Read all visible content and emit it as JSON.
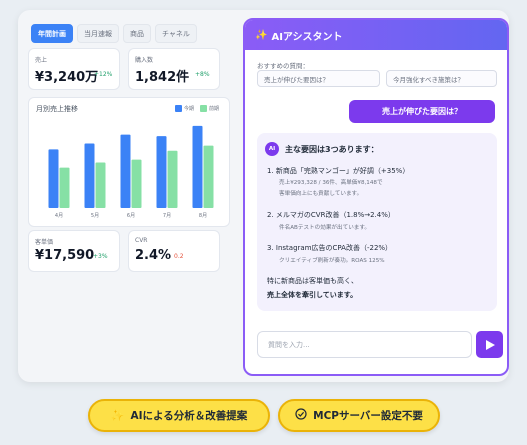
{
  "dashboard": {
    "tabs": [
      {
        "label": "年間計画",
        "active": true
      },
      {
        "label": "当月速報",
        "active": false
      },
      {
        "label": "商品",
        "active": false
      },
      {
        "label": "チャネル",
        "active": false
      }
    ],
    "kpis": [
      {
        "label": "売上",
        "value": "¥3,240万",
        "change": "+12%"
      },
      {
        "label": "購入数",
        "value": "1,842件",
        "change": "+8%"
      },
      {
        "label": "客単価",
        "value": "¥17,590",
        "change": "+3%"
      },
      {
        "label": "CVR",
        "value": "2.4%",
        "change": "0.2"
      }
    ],
    "chart": {
      "title": "月別売上推移",
      "legend": [
        "今期",
        "前期"
      ]
    }
  },
  "chart_data": {
    "type": "bar",
    "categories": [
      "4月",
      "5月",
      "6月",
      "7月",
      "8月"
    ],
    "series": [
      {
        "name": "今期",
        "values": [
          80,
          88,
          100,
          98,
          112
        ]
      },
      {
        "name": "前期",
        "values": [
          55,
          62,
          66,
          78,
          85
        ]
      }
    ],
    "ylim": [
      0,
      120
    ],
    "colors": [
      "#3b82f6",
      "#86e0a5"
    ]
  },
  "assistant": {
    "title": "AIアシスタント",
    "suggest_label": "おすすめの質問：",
    "suggestions": [
      "売上が伸びた要因は？",
      "今月強化すべき施策は？"
    ],
    "user_message": "売上が伸びた要因は？",
    "ai_badge": "AI",
    "answer_title": "主な要因は3つあります：",
    "items": [
      {
        "heading": "1. 新商品「完熟マンゴー」が好調（+35%）",
        "details": [
          "売上¥293,328 / 36件、高単価¥8,148で",
          "客単価向上にも貢献しています。"
        ]
      },
      {
        "heading": "2. メルマガのCVR改善（1.8%→2.4%）",
        "details": [
          "件名ABテストの効果が出ています。"
        ]
      },
      {
        "heading": "3. Instagram広告のCPA改善（-22%）",
        "details": [
          "クリエイティブ刷新が奏功。ROAS 125%"
        ]
      }
    ],
    "summary_line1": "特に新商品は客単価も高く、",
    "summary_line2": "売上全体を牽引しています。",
    "input_placeholder": "質問を入力..."
  },
  "badges": [
    {
      "label": "AIによる分析＆改善提案",
      "icon": "sparkle-icon"
    },
    {
      "label": "MCPサーバー設定不要",
      "icon": "check-circle-icon"
    }
  ],
  "colors": {
    "accent": "#7c3aed",
    "primary": "#3b82f6",
    "badge": "#fde047"
  }
}
